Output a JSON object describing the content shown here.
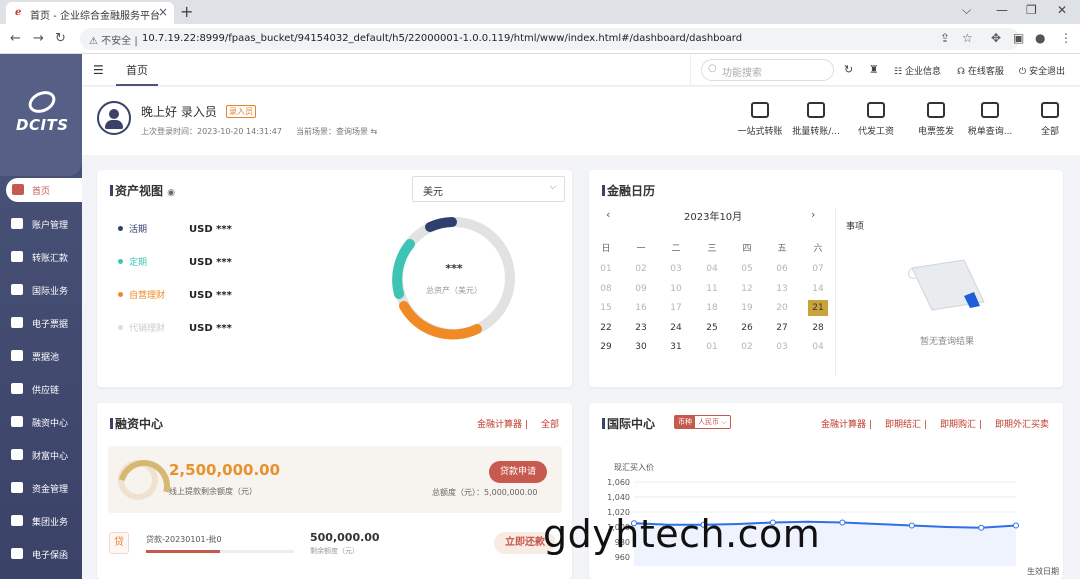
{
  "browser": {
    "tab_title": "首页 - 企业综合金融服务平台",
    "security_label": "不安全",
    "url": "10.7.19.22:8999/fpaas_bucket/94154032_default/h5/22000001-1.0.0.119/html/www/index.html#/dashboard/dashboard"
  },
  "sidebar": {
    "logo_text": "DCITS",
    "items": [
      {
        "label": "首页",
        "active": true
      },
      {
        "label": "账户管理"
      },
      {
        "label": "转账汇款"
      },
      {
        "label": "国际业务"
      },
      {
        "label": "电子票据"
      },
      {
        "label": "票据池"
      },
      {
        "label": "供应链"
      },
      {
        "label": "融资中心"
      },
      {
        "label": "财富中心"
      },
      {
        "label": "资金管理"
      },
      {
        "label": "集团业务"
      },
      {
        "label": "电子保函"
      }
    ]
  },
  "topbar": {
    "home_tab": "首页",
    "search_placeholder": "功能搜索",
    "links": [
      "企业信息",
      "在线客服",
      "安全退出"
    ]
  },
  "welcome": {
    "greeting": "晚上好 录入员",
    "role_badge": "录入员",
    "last_login": "上次登录时间：2023-10-20 14:31:47",
    "scene": "当前场景：查询场景 ⇆",
    "quick_actions": [
      "一站式转账",
      "批量转账/...",
      "代发工资",
      "电票签发",
      "税单查询...",
      "全部"
    ]
  },
  "asset": {
    "title": "资产视图",
    "currency": "美元",
    "items": [
      {
        "name": "活期",
        "value": "USD ***",
        "color": "#2f3f6e"
      },
      {
        "name": "定期",
        "value": "USD ***",
        "color": "#3cc4b4"
      },
      {
        "name": "自营理财",
        "value": "USD ***",
        "color": "#f08a24"
      },
      {
        "name": "代销理财",
        "value": "USD ***",
        "color": "#dddddd"
      }
    ],
    "total_value": "***",
    "total_label": "总资产（美元）"
  },
  "calendar": {
    "title": "金融日历",
    "month": "2023年10月",
    "weekdays": [
      "日",
      "一",
      "二",
      "三",
      "四",
      "五",
      "六"
    ],
    "days": [
      [
        "01",
        "02",
        "03",
        "04",
        "05",
        "06",
        "07"
      ],
      [
        "08",
        "09",
        "10",
        "11",
        "12",
        "13",
        "14"
      ],
      [
        "15",
        "16",
        "17",
        "18",
        "19",
        "20",
        "21"
      ],
      [
        "22",
        "23",
        "24",
        "25",
        "26",
        "27",
        "28"
      ],
      [
        "29",
        "30",
        "31",
        "01",
        "02",
        "03",
        "04"
      ]
    ],
    "today": "21",
    "events_title": "事项",
    "empty_text": "暂无查询结果"
  },
  "finance": {
    "title": "融资中心",
    "links": [
      "金融计算器",
      "全部"
    ],
    "amount": "2,500,000.00",
    "amount_label": "线上提款剩余额度（元）",
    "apply_button": "贷款申请",
    "total": "总额度（元）：5,000,000.00",
    "usage_ratio": 0.5,
    "loan": {
      "icon_text": "贷",
      "name": "贷款-20230101-批0",
      "amount": "500,000.00",
      "amount_label": "剩余额度（元）",
      "progress": 0.5,
      "button": "立即还款"
    }
  },
  "intl": {
    "title": "国际中心",
    "currency_tag": "币种",
    "currency_value": "人民币 ⌵",
    "links": [
      "金融计算器",
      "即期结汇",
      "即期购汇",
      "即期外汇买卖"
    ],
    "y_label": "现汇买入价",
    "x_label": "生效日期"
  },
  "chart_data": {
    "type": "line",
    "ylabel": "现汇买入价",
    "xlabel": "生效日期",
    "ylim": [
      948,
      1060
    ],
    "yticks": [
      960,
      980,
      1000,
      1020,
      1040,
      1060
    ],
    "series": [
      {
        "values": [
          1005,
          1003,
          1003,
          1004,
          1006,
          1007,
          1006,
          1004,
          1002,
          1000,
          999,
          1002
        ]
      }
    ],
    "line_color": "#2f6fe8"
  },
  "watermark": "gdyhtech.com"
}
